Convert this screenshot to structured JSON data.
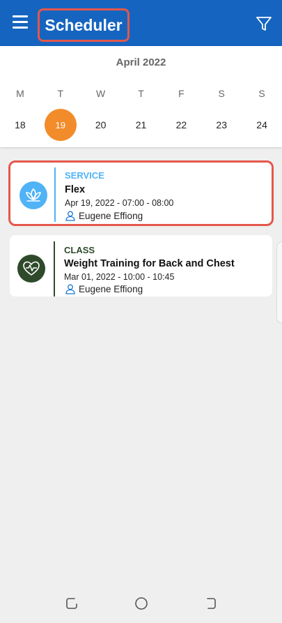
{
  "app_bar": {
    "title": "Scheduler",
    "menu_icon": "hamburger-menu-icon",
    "filter_icon": "filter-icon",
    "color": "#1565c0"
  },
  "calendar": {
    "month": "April 2022",
    "weekdays": [
      "M",
      "T",
      "W",
      "T",
      "F",
      "S",
      "S"
    ],
    "dates": [
      "18",
      "19",
      "20",
      "21",
      "22",
      "23",
      "24"
    ],
    "selected": "19",
    "selected_color": "#f28c2b"
  },
  "appointments": [
    {
      "type": "SERVICE",
      "title": "Flex",
      "time": "Apr 19, 2022 - 07:00 - 08:00",
      "person": "Eugene Effiong",
      "icon": "lotus-icon",
      "color": "#4fb3f6"
    },
    {
      "type": "CLASS",
      "title": "Weight Training for Back and Chest",
      "time": "Mar 01, 2022 - 10:00 - 10:45",
      "person": "Eugene Effiong",
      "icon": "heart-pulse-icon",
      "color": "#2e4a2b"
    }
  ]
}
